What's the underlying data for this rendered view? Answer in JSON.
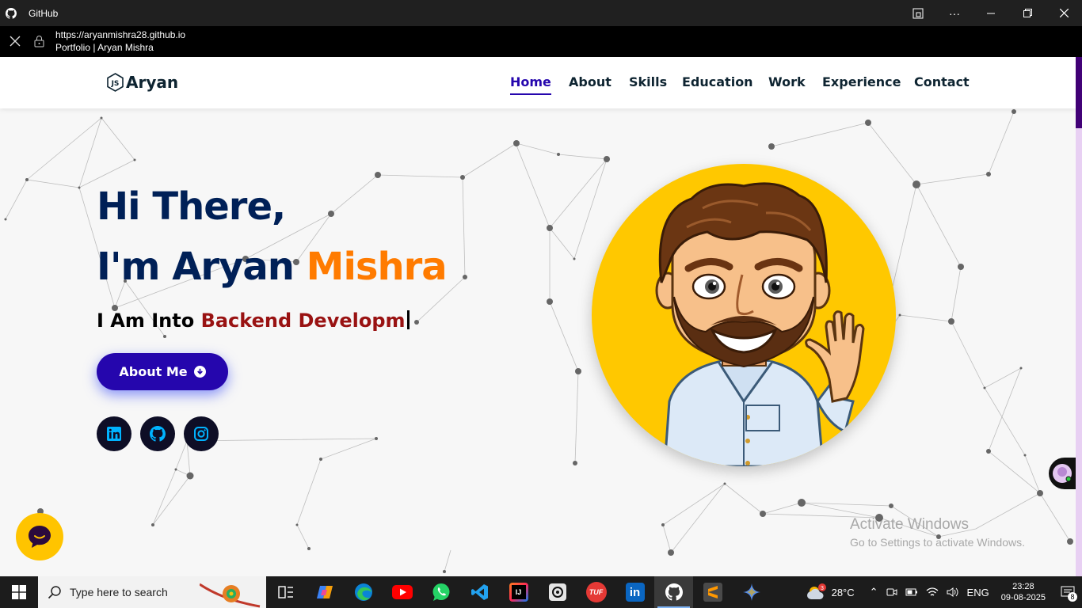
{
  "window": {
    "title": "GitHub",
    "url": "https://aryanmishra28.github.io",
    "page_title": "Portfolio | Aryan Mishra"
  },
  "navbar": {
    "brand": "Aryan",
    "links": [
      {
        "label": "Home",
        "active": true
      },
      {
        "label": "About",
        "active": false
      },
      {
        "label": "Skills",
        "active": false
      },
      {
        "label": "Education",
        "active": false
      },
      {
        "label": "Work",
        "active": false
      },
      {
        "label": "Experience",
        "active": false
      },
      {
        "label": "Contact",
        "active": false
      }
    ]
  },
  "hero": {
    "greeting": "Hi There,",
    "intro_prefix": "I'm Aryan",
    "intro_highlight": "Mishra",
    "typed_prefix": "I Am Into",
    "typed_text": "Backend Developm",
    "about_button": "About Me",
    "socials": [
      {
        "icon": "linkedin-icon"
      },
      {
        "icon": "github-icon"
      },
      {
        "icon": "instagram-icon"
      }
    ]
  },
  "watermark": {
    "line1": "Activate Windows",
    "line2": "Go to Settings to activate Windows."
  },
  "taskbar": {
    "search_placeholder": "Type here to search",
    "weather_badge": "3",
    "temperature": "28°C",
    "language": "ENG",
    "time": "23:28",
    "date": "09-08-2025",
    "notification_count": "8",
    "apps": [
      {
        "name": "task-view"
      },
      {
        "name": "copilot"
      },
      {
        "name": "edge"
      },
      {
        "name": "youtube"
      },
      {
        "name": "whatsapp"
      },
      {
        "name": "vscode"
      },
      {
        "name": "intellij",
        "text": "IJ"
      },
      {
        "name": "chatgpt"
      },
      {
        "name": "tuf",
        "text": "TUF"
      },
      {
        "name": "linkedin",
        "text": "in"
      },
      {
        "name": "github"
      },
      {
        "name": "sublime"
      },
      {
        "name": "gemini"
      }
    ]
  },
  "colors": {
    "primary": "#2506ad",
    "heading": "#002057",
    "accent_orange": "#ff7b00",
    "accent_red": "#991212",
    "avatar_bg": "#ffc800"
  }
}
